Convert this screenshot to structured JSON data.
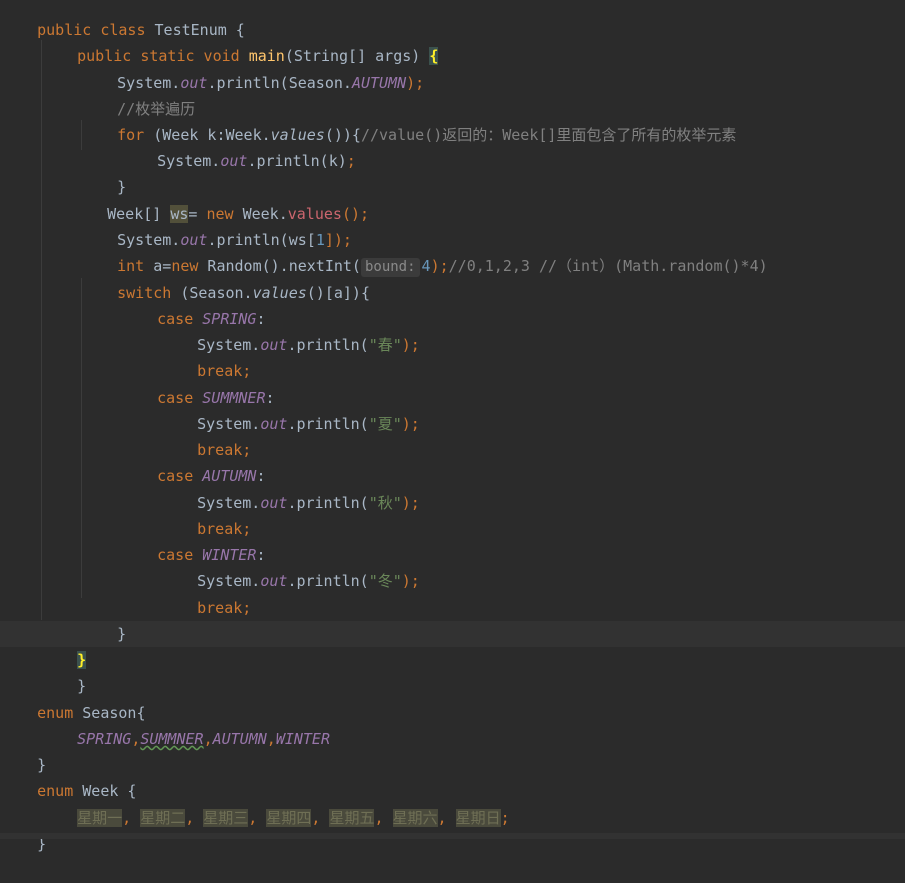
{
  "code": {
    "l0_kw1": "public",
    "l0_kw2": "class",
    "l0_name": "TestEnum {",
    "l1_kw": "public static void",
    "l1_fn": "main",
    "l1_rest": "(String[] args) ",
    "l1_brace": "{",
    "l2_a": "System.",
    "l2_out": "out",
    "l2_b": ".println(Season.",
    "l2_field": "AUTUMN",
    "l2_c": ");",
    "l3_comment": "//枚举遍历",
    "l4_for": "for",
    "l4_a": " (Week k:Week.",
    "l4_values": "values",
    "l4_b": "()){",
    "l4_comment": "//value()返回的：Week[]里面包含了所有的枚举元素",
    "l5_a": "System.",
    "l5_out": "out",
    "l5_b": ".println(k)",
    "l5_c": ";",
    "l6": "}",
    "l7_a": "Week[] ",
    "l7_ws": "ws",
    "l7_b": "= ",
    "l7_new": "new",
    "l7_c": " Week.",
    "l7_values": "values",
    "l7_d": "();",
    "l8_a": "System.",
    "l8_out": "out",
    "l8_b": ".println(ws[",
    "l8_num": "1",
    "l8_c": "]);",
    "l9_int": "int",
    "l9_a": " a=",
    "l9_new": "new",
    "l9_b": " Random().nextInt(",
    "l9_hint": "bound:",
    "l9_num": "4",
    "l9_c": ");",
    "l9_comment": "//0,1,2,3 //（int）(Math.random()*4)",
    "l10_switch": "switch",
    "l10_a": " (Season.",
    "l10_values": "values",
    "l10_b": "()[a]){",
    "cases": [
      {
        "kw": "case",
        "name": "SPRING",
        "colon": ":",
        "print_a": "System.",
        "out": "out",
        "print_b": ".println(",
        "str": "\"春\"",
        "print_c": ");",
        "brk": "break;"
      },
      {
        "kw": "case",
        "name": "SUMMNER",
        "colon": ":",
        "print_a": "System.",
        "out": "out",
        "print_b": ".println(",
        "str": "\"夏\"",
        "print_c": ");",
        "brk": "break;"
      },
      {
        "kw": "case",
        "name": "AUTUMN",
        "colon": ":",
        "print_a": "System.",
        "out": "out",
        "print_b": ".println(",
        "str": "\"秋\"",
        "print_c": ");",
        "brk": "break;"
      },
      {
        "kw": "case",
        "name": "WINTER",
        "colon": ":",
        "print_a": "System.",
        "out": "out",
        "print_b": ".println(",
        "str": "\"冬\"",
        "print_c": ");",
        "brk": "break;"
      }
    ],
    "l23": "}",
    "l24": "}",
    "l25": "}",
    "season_kw": "enum",
    "season_name": "Season{",
    "season_values": [
      "SPRING",
      "SUMMNER",
      "AUTUMN",
      "WINTER"
    ],
    "season_close": "}",
    "week_kw": "enum",
    "week_name": "Week {",
    "week_values": [
      "星期一",
      "星期二",
      "星期三",
      "星期四",
      "星期五",
      "星期六",
      "星期日"
    ],
    "week_close": "}",
    "sep": ",",
    "sep_space": ", ",
    "semicolon": ";"
  },
  "colors": {
    "background": "#2b2b2b",
    "keyword": "#cc7832",
    "function": "#ffc66d",
    "field": "#9876aa",
    "number": "#6897bb",
    "string": "#6a8759",
    "comment": "#808080",
    "text": "#a9b7c6"
  }
}
